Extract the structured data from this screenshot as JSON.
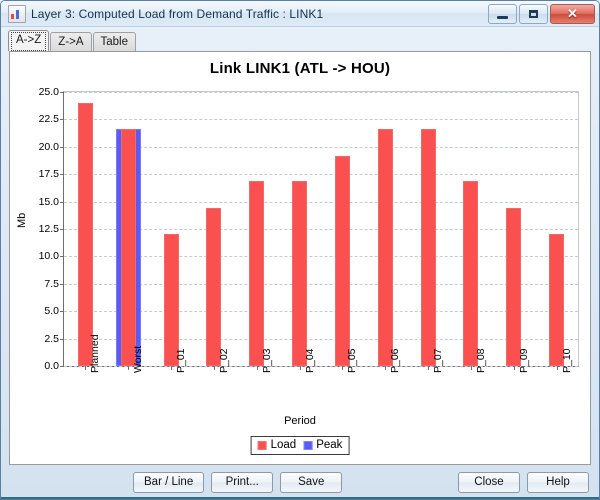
{
  "window": {
    "title": "Layer 3: Computed Load from Demand Traffic : LINK1",
    "icon": "chart-app-icon",
    "controls": {
      "minimize": "minimize-icon",
      "maximize": "maximize-icon",
      "close_glyph": "✕"
    }
  },
  "tabs": [
    {
      "label": "A->Z",
      "selected": true
    },
    {
      "label": "Z->A",
      "selected": false
    },
    {
      "label": "Table",
      "selected": false
    }
  ],
  "buttons": {
    "bar_line": "Bar / Line",
    "print": "Print...",
    "save": "Save",
    "close": "Close",
    "help": "Help"
  },
  "chart_data": {
    "type": "bar",
    "title": "Link LINK1 (ATL -> HOU)",
    "xlabel": "Period",
    "ylabel": "Mb",
    "ylim": [
      0,
      25
    ],
    "ytick_labels": [
      "25.0",
      "22.5",
      "20.0",
      "17.5",
      "15.0",
      "12.5",
      "10.0",
      "7.5",
      "5.0",
      "2.5",
      "0.0"
    ],
    "ytick_values": [
      25.0,
      22.5,
      20.0,
      17.5,
      15.0,
      12.5,
      10.0,
      7.5,
      5.0,
      2.5,
      0.0
    ],
    "grid": true,
    "legend_position": "bottom",
    "categories": [
      "Planned",
      "Worst",
      "P_01",
      "P_02",
      "P_03",
      "P_04",
      "P_05",
      "P_06",
      "P_07",
      "P_08",
      "P_09",
      "P_10"
    ],
    "series": [
      {
        "name": "Load",
        "color": "#fa5050",
        "values": [
          24.0,
          21.6,
          12.0,
          14.4,
          16.9,
          16.9,
          19.2,
          21.6,
          21.6,
          16.9,
          14.4,
          12.0
        ]
      },
      {
        "name": "Peak",
        "color": "#5a5af5",
        "values": [
          null,
          21.6,
          null,
          null,
          null,
          null,
          null,
          null,
          null,
          null,
          null,
          null
        ]
      }
    ]
  }
}
